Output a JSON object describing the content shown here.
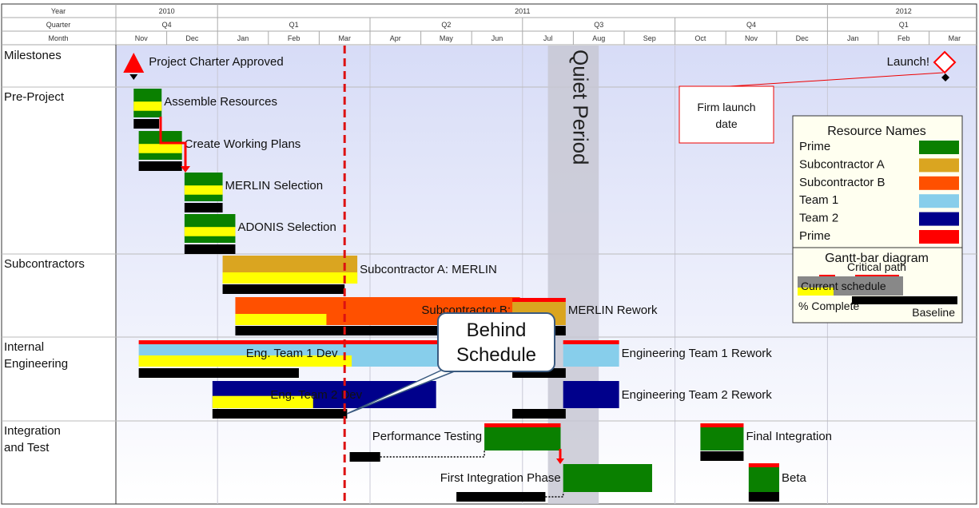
{
  "chart_data": {
    "type": "gantt",
    "timescale": {
      "labels": [
        "Year",
        "Quarter",
        "Month"
      ],
      "years": [
        {
          "label": "2010",
          "start": 0,
          "end": 2
        },
        {
          "label": "2011",
          "start": 2,
          "end": 14
        },
        {
          "label": "2012",
          "start": 14,
          "end": 17
        }
      ],
      "quarters": [
        {
          "label": "Q4",
          "start": 0,
          "end": 2
        },
        {
          "label": "Q1",
          "start": 2,
          "end": 5
        },
        {
          "label": "Q2",
          "start": 5,
          "end": 8
        },
        {
          "label": "Q3",
          "start": 8,
          "end": 11
        },
        {
          "label": "Q4",
          "start": 11,
          "end": 14
        },
        {
          "label": "Q1",
          "start": 14,
          "end": 17
        }
      ],
      "months": [
        "Nov",
        "Dec",
        "Jan",
        "Feb",
        "Mar",
        "Apr",
        "May",
        "Jun",
        "Jul",
        "Aug",
        "Sep",
        "Oct",
        "Nov",
        "Dec",
        "Jan",
        "Feb",
        "Mar"
      ]
    },
    "today_marker": 4.5,
    "quiet_period": {
      "label": "Quiet Period",
      "start": 8.5,
      "end": 9.5
    },
    "rows": [
      {
        "label": "Milestones",
        "tasks": [
          {
            "name": "Project Charter Approved",
            "kind": "milestone-start",
            "date": 0.35
          },
          {
            "name": "Launch!",
            "kind": "milestone",
            "date": 16.4
          }
        ]
      },
      {
        "label": "Pre-Project",
        "tasks": [
          {
            "name": "Assemble Resources",
            "start": 0.35,
            "end": 0.9,
            "progress": 1.0,
            "resource": "Prime",
            "baseline": [
              0.35,
              0.85
            ]
          },
          {
            "name": "Create Working Plans",
            "start": 0.45,
            "end": 1.3,
            "progress": 1.0,
            "resource": "Prime",
            "baseline": [
              0.45,
              1.3
            ]
          },
          {
            "name": "MERLIN Selection",
            "start": 1.35,
            "end": 2.1,
            "progress": 1.0,
            "resource": "Prime",
            "baseline": [
              1.35,
              2.1
            ]
          },
          {
            "name": "ADONIS Selection",
            "start": 1.35,
            "end": 2.35,
            "progress": 1.0,
            "resource": "Prime",
            "baseline": [
              1.35,
              2.35
            ]
          }
        ]
      },
      {
        "label": "Subcontractors",
        "tasks": [
          {
            "name": "Subcontractor A: MERLIN",
            "start": 2.1,
            "end": 4.75,
            "progress": 1.0,
            "resource": "Subcontractor A",
            "baseline": [
              2.1,
              4.5
            ]
          },
          {
            "name": "Subcontractor B: ADONIS",
            "start": 2.35,
            "end": 7.95,
            "progress": 0.32,
            "resource": "Subcontractor B",
            "baseline": [
              2.35,
              6.55
            ]
          },
          {
            "name": "MERLIN Rework",
            "start": 7.8,
            "end": 8.85,
            "progress": 1.0,
            "resource": "Subcontractor A",
            "critical": true,
            "baseline": [
              7.8,
              8.85
            ]
          }
        ]
      },
      {
        "label": "Internal Engineering",
        "tasks": [
          {
            "name": "Eng. Team 1 Dev",
            "start": 0.45,
            "end": 7.1,
            "progress": 0.63,
            "resource": "Team 1",
            "critical": true,
            "baseline": [
              0.45,
              3.6
            ]
          },
          {
            "name": "Engineering Team 1 Rework",
            "start": 8.8,
            "end": 9.9,
            "progress": 1.0,
            "resource": "Team 1",
            "critical": true,
            "baseline": [
              7.8,
              8.85
            ]
          },
          {
            "name": "Eng. Team 2 Dev",
            "start": 1.9,
            "end": 6.3,
            "progress": 0.45,
            "resource": "Team 2",
            "baseline": [
              1.9,
              4.55
            ]
          },
          {
            "name": "Engineering Team 2 Rework",
            "start": 8.8,
            "end": 9.9,
            "progress": 1.0,
            "resource": "Team 2",
            "baseline": [
              7.8,
              8.85
            ]
          }
        ]
      },
      {
        "label": "Integration and Test",
        "tasks": [
          {
            "name": "Performance Testing",
            "start": 7.25,
            "end": 8.75,
            "progress": 1.0,
            "resource": "Prime",
            "critical": true,
            "baseline": [
              4.6,
              5.2
            ]
          },
          {
            "name": "First Integration Phase",
            "start": 8.8,
            "end": 10.55,
            "progress": 1.0,
            "resource": "Prime",
            "baseline": [
              6.7,
              8.45
            ]
          },
          {
            "name": "Final Integration",
            "start": 11.5,
            "end": 12.35,
            "progress": 1.0,
            "resource": "Prime",
            "critical": true,
            "baseline": [
              11.5,
              12.35
            ]
          },
          {
            "name": "Beta",
            "start": 12.45,
            "end": 13.05,
            "progress": 1.0,
            "resource": "Prime",
            "critical": true,
            "baseline": [
              12.45,
              13.05
            ]
          }
        ]
      }
    ],
    "legend_resources": {
      "title": "Resource Names",
      "items": [
        {
          "name": "Prime",
          "color": "#0a8000"
        },
        {
          "name": "Subcontractor A",
          "color": "#daa520"
        },
        {
          "name": "Subcontractor B",
          "color": "#ff5000"
        },
        {
          "name": "Team 1",
          "color": "#87ceeb"
        },
        {
          "name": "Team 2",
          "color": "#00008b"
        },
        {
          "name": "Prime",
          "color": "#ff0000"
        }
      ]
    },
    "legend_bars": {
      "title": "Gantt-bar diagram",
      "items": [
        "Critical path",
        "Current schedule",
        "% Complete",
        "Baseline"
      ]
    },
    "annotations": {
      "firm_launch": "Firm launch date",
      "behind_schedule": "Behind Schedule"
    },
    "colors": {
      "critical": "#ff0000",
      "progress": "#ffff00",
      "baseline": "#000000",
      "today": "#dd1111",
      "quiet": "#c8c8d4"
    }
  }
}
